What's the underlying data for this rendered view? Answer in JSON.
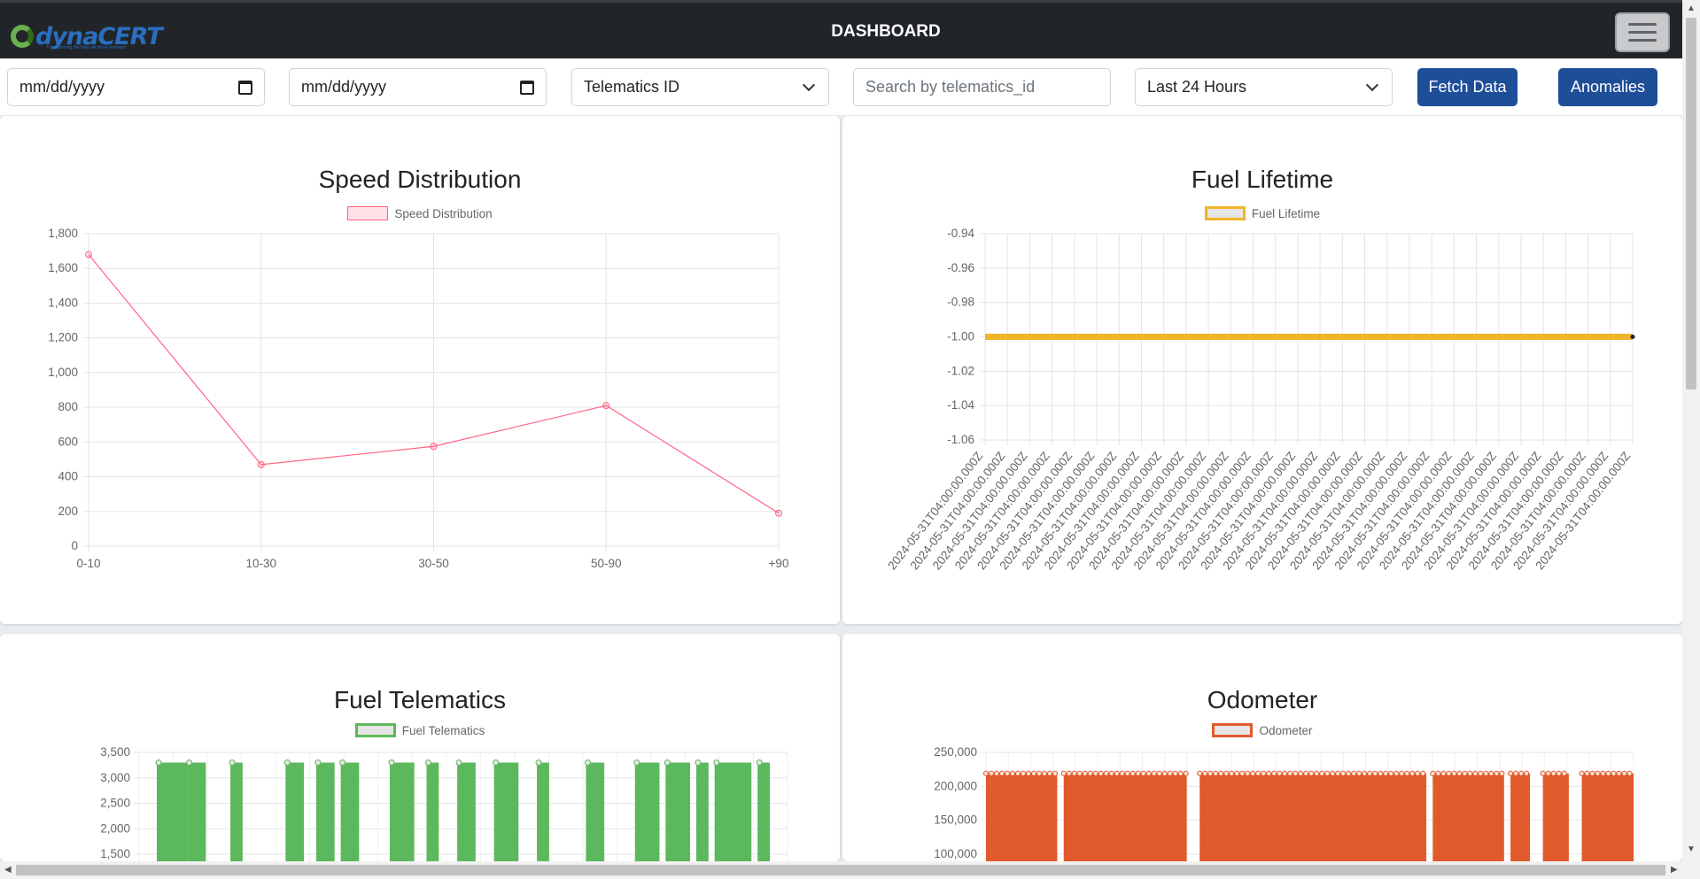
{
  "header": {
    "logo_text": "dynaCERT",
    "logo_tagline": "Transforming the Way we Move Forward",
    "title": "DASHBOARD"
  },
  "filters": {
    "start_date_placeholder": "mm/dd/yyyy",
    "end_date_placeholder": "mm/dd/yyyy",
    "telematics_select": "Telematics ID",
    "search_placeholder": "Search by telematics_id",
    "range_select": "Last 24 Hours",
    "fetch_label": "Fetch Data",
    "anomalies_label": "Anomalies"
  },
  "colors": {
    "navbar": "#212529",
    "button": "#1f4e99",
    "speed": "#ff6384",
    "fuel_lifetime": "#f0b429",
    "fuel_telematics": "#5cb85c",
    "odometer": "#e05a2b"
  },
  "chart_data": [
    {
      "type": "line",
      "title": "Speed Distribution",
      "series": [
        {
          "name": "Speed Distribution",
          "values": [
            1680,
            470,
            575,
            810,
            190
          ]
        }
      ],
      "categories": [
        "0-10",
        "10-30",
        "30-50",
        "50-90",
        "+90"
      ],
      "ylim": [
        0,
        1800
      ],
      "yticks": [
        "1,800",
        "1,600",
        "1,400",
        "1,200",
        "1,000",
        "800",
        "600",
        "400",
        "200",
        "0"
      ],
      "grid": true,
      "legend": "top"
    },
    {
      "type": "line",
      "title": "Fuel Lifetime",
      "series": [
        {
          "name": "Fuel Lifetime",
          "value": -1.0
        }
      ],
      "x_tick_label": "2024-05-31T04:00:00.000Z",
      "x_tick_count": 30,
      "ylim": [
        -1.06,
        -0.94
      ],
      "yticks": [
        "-0.94",
        "-0.96",
        "-0.98",
        "-1.00",
        "-1.02",
        "-1.04",
        "-1.06"
      ],
      "grid": true,
      "legend": "top"
    },
    {
      "type": "bar",
      "title": "Fuel Telematics",
      "series": [
        {
          "name": "Fuel Telematics",
          "value_approx": 3300
        }
      ],
      "ylim": [
        1500,
        3500
      ],
      "yticks": [
        "3,500",
        "3,000",
        "2,500",
        "2,000",
        "1,500"
      ],
      "grid": true,
      "legend": "top"
    },
    {
      "type": "area",
      "title": "Odometer",
      "series": [
        {
          "name": "Odometer",
          "value_approx": 219000
        }
      ],
      "ylim": [
        100000,
        250000
      ],
      "yticks": [
        "250,000",
        "200,000",
        "150,000",
        "100,000"
      ],
      "grid": true,
      "legend": "top"
    }
  ]
}
